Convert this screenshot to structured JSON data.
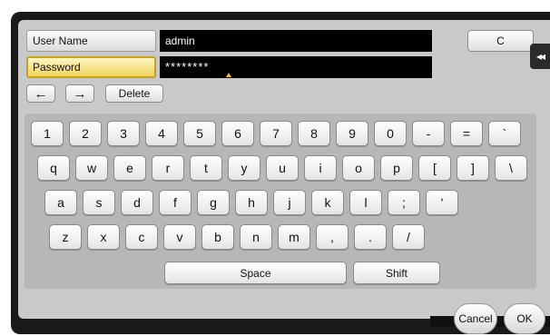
{
  "form": {
    "user_name_label": "User Name",
    "user_name_value": "admin",
    "password_label": "Password",
    "password_value": "********",
    "clear_label": "C"
  },
  "side_tab_glyph": "◂◂",
  "edit": {
    "left_arrow": "←",
    "right_arrow": "→",
    "delete_label": "Delete"
  },
  "keyboard": {
    "rows": [
      [
        "1",
        "2",
        "3",
        "4",
        "5",
        "6",
        "7",
        "8",
        "9",
        "0",
        "-",
        "=",
        "`"
      ],
      [
        "q",
        "w",
        "e",
        "r",
        "t",
        "y",
        "u",
        "i",
        "o",
        "p",
        "[",
        "]",
        "\\"
      ],
      [
        "a",
        "s",
        "d",
        "f",
        "g",
        "h",
        "j",
        "k",
        "l",
        ";",
        "'"
      ],
      [
        "z",
        "x",
        "c",
        "v",
        "b",
        "n",
        "m",
        ",",
        ".",
        "/"
      ]
    ],
    "space_label": "Space",
    "shift_label": "Shift"
  },
  "footer": {
    "cancel_label": "Cancel",
    "ok_label": "OK"
  },
  "colors": {
    "active_field": "#f2d35a",
    "field_background": "#000000",
    "panel": "#c9c9c9"
  }
}
